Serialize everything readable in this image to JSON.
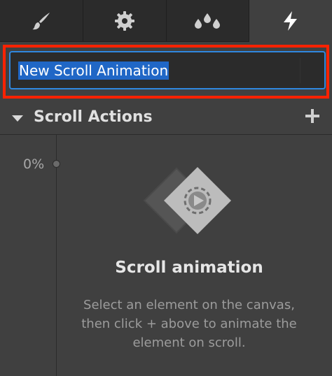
{
  "tabs": [
    {
      "icon": "brush-icon",
      "active": false
    },
    {
      "icon": "gear-icon",
      "active": false
    },
    {
      "icon": "drops-icon",
      "active": false
    },
    {
      "icon": "lightning-icon",
      "active": true
    }
  ],
  "animation_name": {
    "value": "New Scroll Animation",
    "selected": true
  },
  "scroll_actions": {
    "title": "Scroll Actions",
    "add_icon": "plus-icon"
  },
  "timeline": {
    "start_label": "0%"
  },
  "empty_state": {
    "title": "Scroll animation",
    "description": "Select an element on the canvas, then click + above to animate the element on scroll."
  },
  "colors": {
    "panel_bg": "#404040",
    "tab_bar_bg": "#2b2b2b",
    "input_border": "#2f88e0",
    "selection": "#2067c6",
    "highlight": "#ff2200"
  }
}
